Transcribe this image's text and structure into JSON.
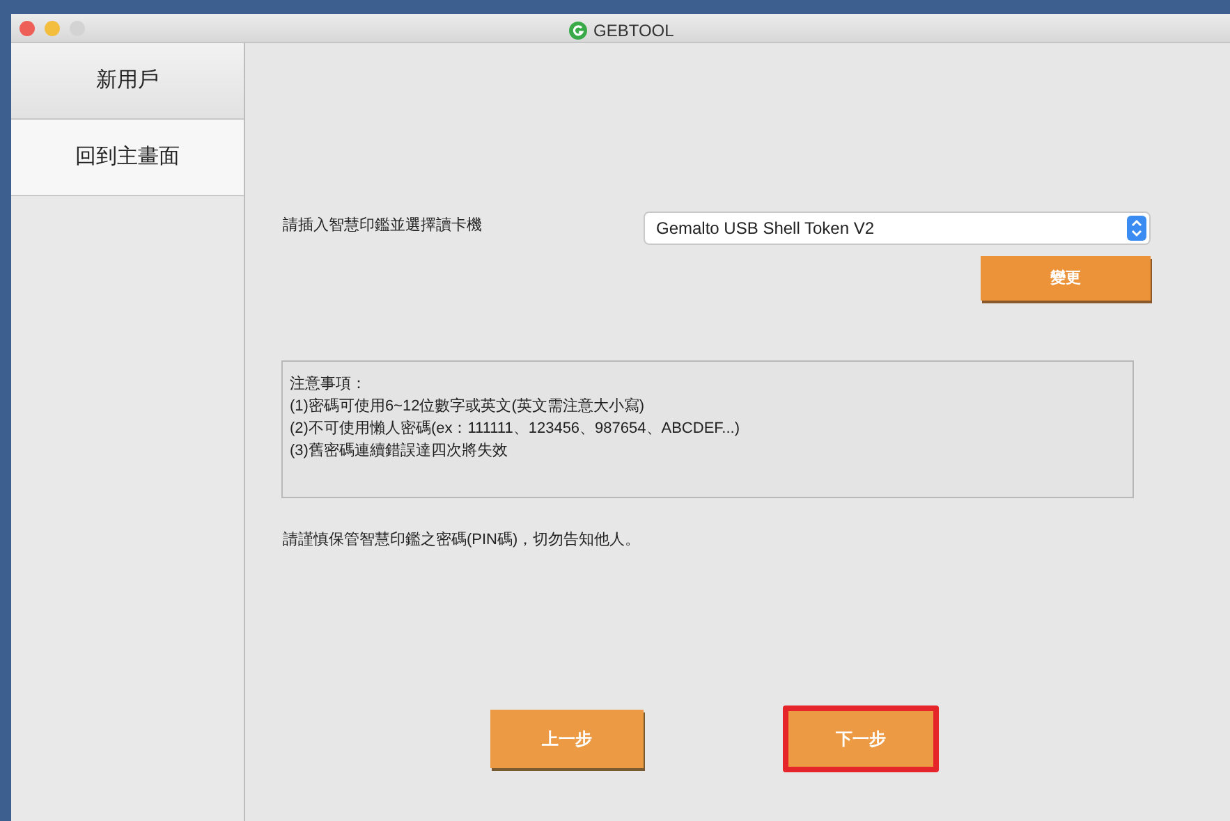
{
  "window": {
    "title": "GEBTOOL"
  },
  "sidebar": {
    "items": [
      {
        "label": "新用戶",
        "selected": false
      },
      {
        "label": "回到主畫面",
        "selected": true
      }
    ]
  },
  "reader": {
    "label": "請插入智慧印鑑並選擇讀卡機",
    "value": "Gemalto USB Shell Token V2",
    "change_button": "變更"
  },
  "notice": {
    "lines": [
      "注意事項：",
      "(1)密碼可使用6~12位數字或英文(英文需注意大小寫)",
      "(2)不可使用懶人密碼(ex：111111、123456、987654、ABCDEF...)",
      "(3)舊密碼連續錯誤達四次將失效"
    ]
  },
  "warning": "請謹慎保管智慧印鑑之密碼(PIN碼)，切勿告知他人。",
  "buttons": [
    {
      "label": "上一步",
      "highlighted": false
    },
    {
      "label": "下一步",
      "highlighted": true
    }
  ]
}
